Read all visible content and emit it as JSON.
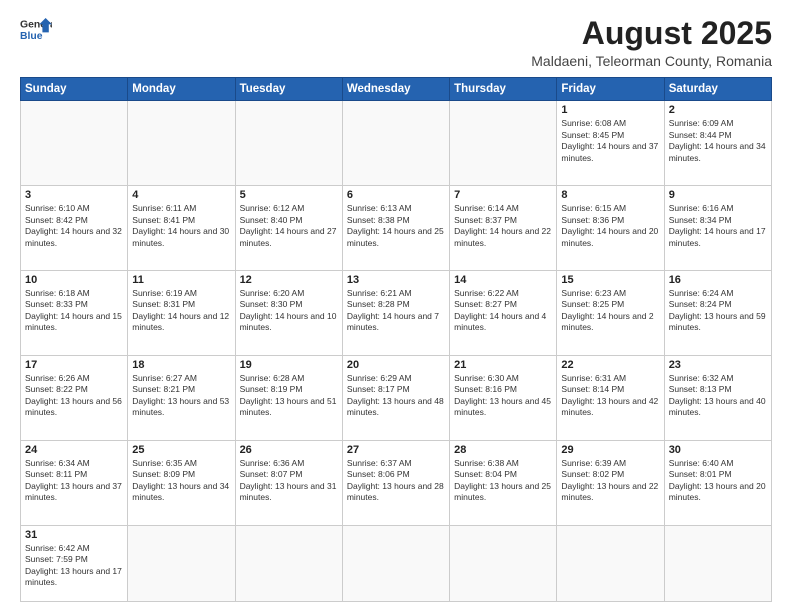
{
  "header": {
    "logo_general": "General",
    "logo_blue": "Blue",
    "month_title": "August 2025",
    "subtitle": "Maldaeni, Teleorman County, Romania"
  },
  "weekdays": [
    "Sunday",
    "Monday",
    "Tuesday",
    "Wednesday",
    "Thursday",
    "Friday",
    "Saturday"
  ],
  "weeks": [
    [
      {
        "day": "",
        "info": ""
      },
      {
        "day": "",
        "info": ""
      },
      {
        "day": "",
        "info": ""
      },
      {
        "day": "",
        "info": ""
      },
      {
        "day": "",
        "info": ""
      },
      {
        "day": "1",
        "info": "Sunrise: 6:08 AM\nSunset: 8:45 PM\nDaylight: 14 hours and 37 minutes."
      },
      {
        "day": "2",
        "info": "Sunrise: 6:09 AM\nSunset: 8:44 PM\nDaylight: 14 hours and 34 minutes."
      }
    ],
    [
      {
        "day": "3",
        "info": "Sunrise: 6:10 AM\nSunset: 8:42 PM\nDaylight: 14 hours and 32 minutes."
      },
      {
        "day": "4",
        "info": "Sunrise: 6:11 AM\nSunset: 8:41 PM\nDaylight: 14 hours and 30 minutes."
      },
      {
        "day": "5",
        "info": "Sunrise: 6:12 AM\nSunset: 8:40 PM\nDaylight: 14 hours and 27 minutes."
      },
      {
        "day": "6",
        "info": "Sunrise: 6:13 AM\nSunset: 8:38 PM\nDaylight: 14 hours and 25 minutes."
      },
      {
        "day": "7",
        "info": "Sunrise: 6:14 AM\nSunset: 8:37 PM\nDaylight: 14 hours and 22 minutes."
      },
      {
        "day": "8",
        "info": "Sunrise: 6:15 AM\nSunset: 8:36 PM\nDaylight: 14 hours and 20 minutes."
      },
      {
        "day": "9",
        "info": "Sunrise: 6:16 AM\nSunset: 8:34 PM\nDaylight: 14 hours and 17 minutes."
      }
    ],
    [
      {
        "day": "10",
        "info": "Sunrise: 6:18 AM\nSunset: 8:33 PM\nDaylight: 14 hours and 15 minutes."
      },
      {
        "day": "11",
        "info": "Sunrise: 6:19 AM\nSunset: 8:31 PM\nDaylight: 14 hours and 12 minutes."
      },
      {
        "day": "12",
        "info": "Sunrise: 6:20 AM\nSunset: 8:30 PM\nDaylight: 14 hours and 10 minutes."
      },
      {
        "day": "13",
        "info": "Sunrise: 6:21 AM\nSunset: 8:28 PM\nDaylight: 14 hours and 7 minutes."
      },
      {
        "day": "14",
        "info": "Sunrise: 6:22 AM\nSunset: 8:27 PM\nDaylight: 14 hours and 4 minutes."
      },
      {
        "day": "15",
        "info": "Sunrise: 6:23 AM\nSunset: 8:25 PM\nDaylight: 14 hours and 2 minutes."
      },
      {
        "day": "16",
        "info": "Sunrise: 6:24 AM\nSunset: 8:24 PM\nDaylight: 13 hours and 59 minutes."
      }
    ],
    [
      {
        "day": "17",
        "info": "Sunrise: 6:26 AM\nSunset: 8:22 PM\nDaylight: 13 hours and 56 minutes."
      },
      {
        "day": "18",
        "info": "Sunrise: 6:27 AM\nSunset: 8:21 PM\nDaylight: 13 hours and 53 minutes."
      },
      {
        "day": "19",
        "info": "Sunrise: 6:28 AM\nSunset: 8:19 PM\nDaylight: 13 hours and 51 minutes."
      },
      {
        "day": "20",
        "info": "Sunrise: 6:29 AM\nSunset: 8:17 PM\nDaylight: 13 hours and 48 minutes."
      },
      {
        "day": "21",
        "info": "Sunrise: 6:30 AM\nSunset: 8:16 PM\nDaylight: 13 hours and 45 minutes."
      },
      {
        "day": "22",
        "info": "Sunrise: 6:31 AM\nSunset: 8:14 PM\nDaylight: 13 hours and 42 minutes."
      },
      {
        "day": "23",
        "info": "Sunrise: 6:32 AM\nSunset: 8:13 PM\nDaylight: 13 hours and 40 minutes."
      }
    ],
    [
      {
        "day": "24",
        "info": "Sunrise: 6:34 AM\nSunset: 8:11 PM\nDaylight: 13 hours and 37 minutes."
      },
      {
        "day": "25",
        "info": "Sunrise: 6:35 AM\nSunset: 8:09 PM\nDaylight: 13 hours and 34 minutes."
      },
      {
        "day": "26",
        "info": "Sunrise: 6:36 AM\nSunset: 8:07 PM\nDaylight: 13 hours and 31 minutes."
      },
      {
        "day": "27",
        "info": "Sunrise: 6:37 AM\nSunset: 8:06 PM\nDaylight: 13 hours and 28 minutes."
      },
      {
        "day": "28",
        "info": "Sunrise: 6:38 AM\nSunset: 8:04 PM\nDaylight: 13 hours and 25 minutes."
      },
      {
        "day": "29",
        "info": "Sunrise: 6:39 AM\nSunset: 8:02 PM\nDaylight: 13 hours and 22 minutes."
      },
      {
        "day": "30",
        "info": "Sunrise: 6:40 AM\nSunset: 8:01 PM\nDaylight: 13 hours and 20 minutes."
      }
    ],
    [
      {
        "day": "31",
        "info": "Sunrise: 6:42 AM\nSunset: 7:59 PM\nDaylight: 13 hours and 17 minutes."
      },
      {
        "day": "",
        "info": ""
      },
      {
        "day": "",
        "info": ""
      },
      {
        "day": "",
        "info": ""
      },
      {
        "day": "",
        "info": ""
      },
      {
        "day": "",
        "info": ""
      },
      {
        "day": "",
        "info": ""
      }
    ]
  ]
}
